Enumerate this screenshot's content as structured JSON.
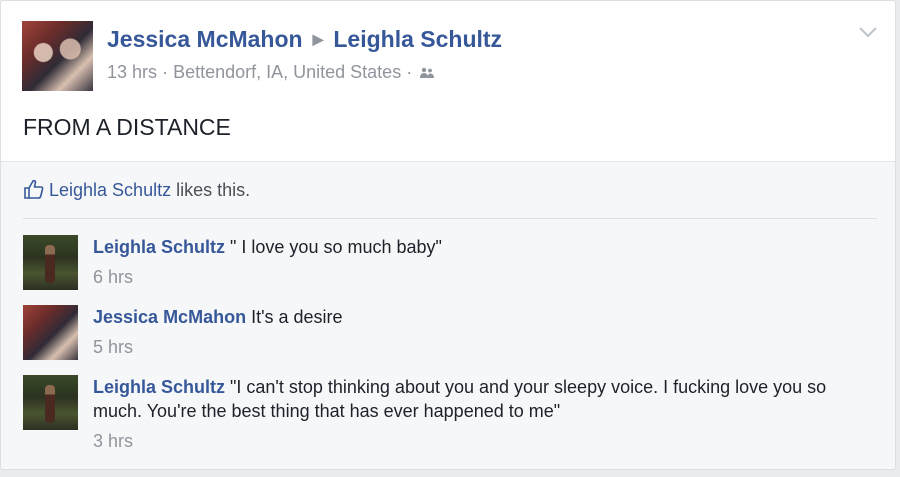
{
  "post": {
    "author": "Jessica McMahon",
    "target": "Leighla Schultz",
    "time": "13 hrs",
    "separator": "·",
    "location": "Bettendorf, IA, United States",
    "audience_icon": "friends-icon",
    "text": "FROM A DISTANCE"
  },
  "likes": {
    "liker": "Leighla Schultz",
    "suffix": " likes this."
  },
  "comments": [
    {
      "author": "Leighla Schultz",
      "text": " \" I love you so much baby\"",
      "time": "6 hrs"
    },
    {
      "author": "Jessica McMahon",
      "text": " It's a desire",
      "time": "5 hrs"
    },
    {
      "author": "Leighla Schultz",
      "text": " \"I can't stop thinking about you and your sleepy voice. I fucking love you so much. You're the best thing that has ever happened to me\"",
      "time": "3 hrs"
    }
  ],
  "colors": {
    "link": "#365899",
    "meta": "#90949c",
    "text": "#1d2129",
    "footer_bg": "#f6f7f9"
  }
}
